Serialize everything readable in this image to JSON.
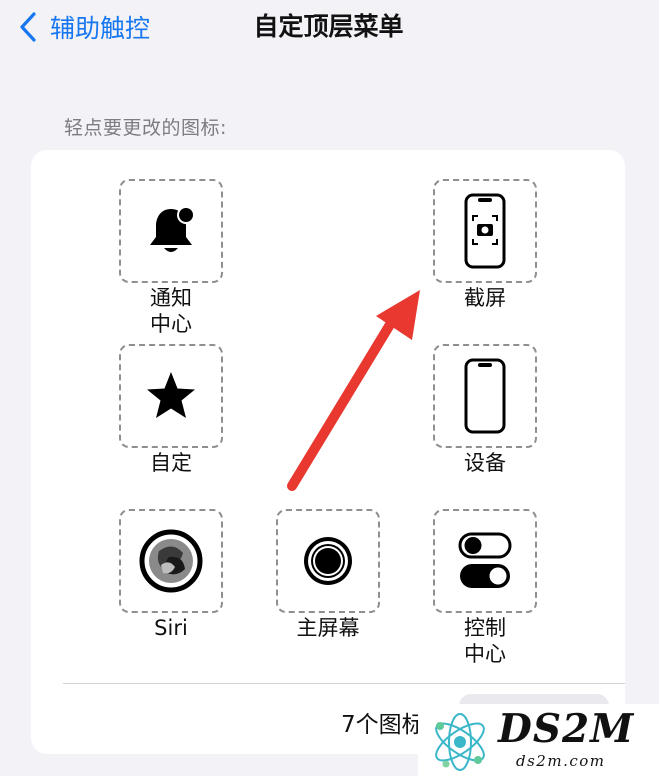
{
  "nav": {
    "back_label": "辅助触控",
    "title": "自定顶层菜单"
  },
  "section_label": "轻点要更改的图标:",
  "icons": [
    {
      "label": "通知\n中心",
      "icon": "notification-center-bell-icon"
    },
    {
      "label": "截屏",
      "icon": "screenshot-icon"
    },
    {
      "label": "自定",
      "icon": "star-icon"
    },
    {
      "label": "设备",
      "icon": "device-phone-icon"
    },
    {
      "label": "Siri",
      "icon": "siri-icon"
    },
    {
      "label": "主屏幕",
      "icon": "home-button-icon"
    },
    {
      "label": "控制\n中心",
      "icon": "control-center-toggles-icon"
    }
  ],
  "footer": {
    "count_label": "7个图标"
  },
  "watermark": {
    "brand": "DS2M",
    "domain": "ds2m.com"
  },
  "colors": {
    "accent": "#1677f0",
    "arrow": "#e8382f",
    "background": "#f2f2f7"
  }
}
